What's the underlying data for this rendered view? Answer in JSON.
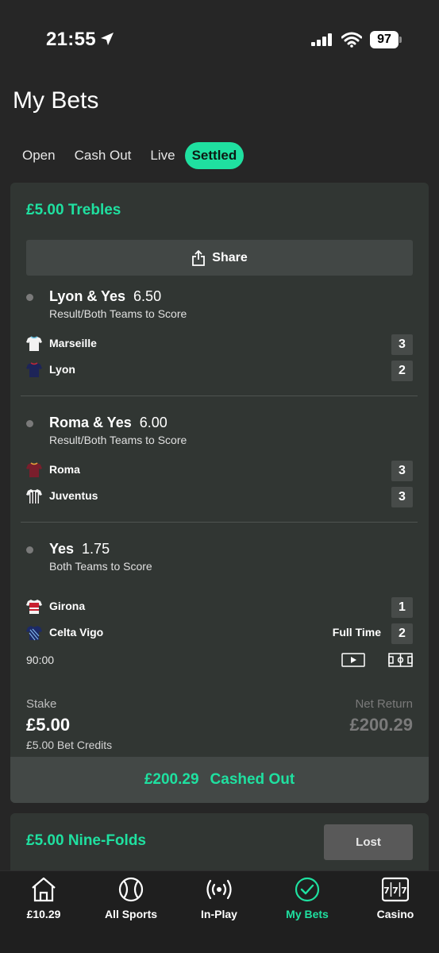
{
  "status_bar": {
    "time": "21:55",
    "battery": "97"
  },
  "page_title": "My Bets",
  "tabs": [
    {
      "label": "Open"
    },
    {
      "label": "Cash Out"
    },
    {
      "label": "Live"
    },
    {
      "label": "Settled",
      "active": true
    }
  ],
  "bet": {
    "title": "£5.00 Trebles",
    "share_label": "Share",
    "legs": [
      {
        "selection": "Lyon & Yes",
        "odds": "6.50",
        "market": "Result/Both Teams to Score",
        "teams": [
          {
            "name": "Marseille",
            "score": "3",
            "kit": "marseille-kit-icon"
          },
          {
            "name": "Lyon",
            "score": "2",
            "kit": "lyon-kit-icon"
          }
        ]
      },
      {
        "selection": "Roma & Yes",
        "odds": "6.00",
        "market": "Result/Both Teams to Score",
        "teams": [
          {
            "name": "Roma",
            "score": "3",
            "kit": "roma-kit-icon"
          },
          {
            "name": "Juventus",
            "score": "3",
            "kit": "juventus-kit-icon"
          }
        ]
      },
      {
        "selection": "Yes",
        "odds": "1.75",
        "market": "Both Teams to Score",
        "teams": [
          {
            "name": "Girona",
            "score": "1",
            "kit": "girona-kit-icon"
          },
          {
            "name": "Celta Vigo",
            "score": "2",
            "kit": "celta-vigo-kit-icon"
          }
        ],
        "status": "Full Time",
        "clock": "90:00"
      }
    ],
    "stake_label": "Stake",
    "stake": "£5.00",
    "stake_note": "£5.00 Bet Credits",
    "net_return_label": "Net Return",
    "net_return": "£200.29",
    "cashed_amount": "£200.29",
    "cashed_label": "Cashed Out"
  },
  "bet2": {
    "title": "£5.00 Nine-Folds",
    "result_label": "Lost"
  },
  "nav": [
    {
      "label": "£10.29",
      "icon": "home-icon"
    },
    {
      "label": "All Sports",
      "icon": "ball-icon"
    },
    {
      "label": "In-Play",
      "icon": "broadcast-icon"
    },
    {
      "label": "My Bets",
      "icon": "check-circle-icon",
      "active": true
    },
    {
      "label": "Casino",
      "icon": "slot-machine-icon"
    }
  ],
  "colors": {
    "accent": "#1fe0a0",
    "background": "#262626",
    "card": "#313633"
  }
}
